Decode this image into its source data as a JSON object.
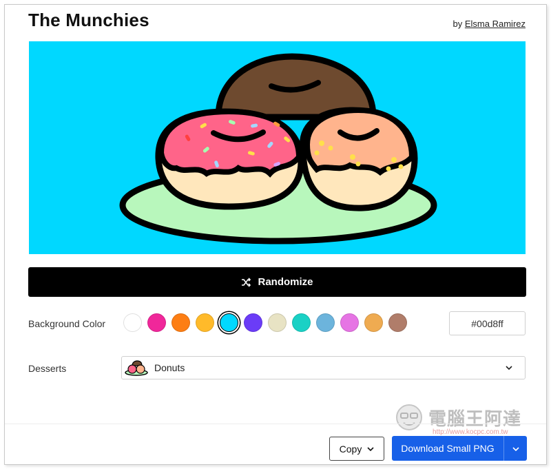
{
  "header": {
    "title": "The Munchies",
    "by_prefix": "by",
    "author": "Elsma Ramirez"
  },
  "canvas": {
    "background": "#00d8ff",
    "image": "donuts-illustration"
  },
  "randomize": {
    "label": "Randomize",
    "icon": "shuffle-icon"
  },
  "background_color": {
    "label": "Background Color",
    "swatches": [
      "#ffffff",
      "#f0279a",
      "#fd7e14",
      "#ffba2a",
      "#00d8ff",
      "#6b3cf7",
      "#e8e3c4",
      "#1ad1c5",
      "#6cb4dc",
      "#e674e4",
      "#efab51",
      "#b07d6a"
    ],
    "selected": "#00d8ff",
    "hex_value": "#00d8ff"
  },
  "desserts": {
    "label": "Desserts",
    "selected": "Donuts",
    "icon": "donuts-thumbnail-icon"
  },
  "footer": {
    "copy_label": "Copy",
    "download_label": "Download Small PNG"
  },
  "watermark": {
    "text": "電腦王阿達",
    "url": "http://www.kocpc.com.tw"
  }
}
